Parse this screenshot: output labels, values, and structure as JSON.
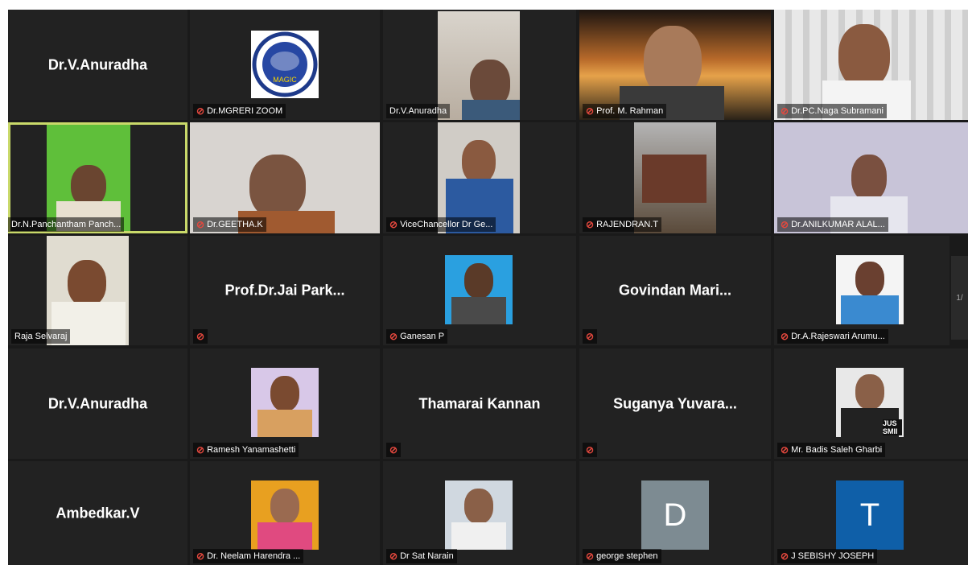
{
  "participants": [
    {
      "big": "Dr.V.Anuradha"
    },
    {
      "label": "Dr.MGRERI ZOOM",
      "logo": "MAGIC"
    },
    {
      "label": "Dr.V.Anuradha"
    },
    {
      "label": "Prof. M. Rahman"
    },
    {
      "label": "Dr.PC.Naga Subramani"
    },
    {
      "label": "Dr.N.Panchantham Panch..."
    },
    {
      "label": "Dr.GEETHA.K"
    },
    {
      "label": "ViceChancellor Dr Ge..."
    },
    {
      "label": "RAJENDRAN.T"
    },
    {
      "label": "Dr.ANILKUMAR ALAL..."
    },
    {
      "label": "Raja Selvaraj"
    },
    {
      "big": "Prof.Dr.Jai  Park..."
    },
    {
      "label": "Ganesan P"
    },
    {
      "big": "Govindan  Mari..."
    },
    {
      "label": "Dr.A.Rajeswari Arumu..."
    },
    {
      "big": "Dr.V.Anuradha"
    },
    {
      "label": "Ramesh Yanamashetti"
    },
    {
      "big": "Thamarai Kannan"
    },
    {
      "big": "Suganya  Yuvara..."
    },
    {
      "label": "Mr. Badis Saleh Gharbi",
      "poster": "JUS SMII"
    },
    {
      "big": "Ambedkar.V"
    },
    {
      "label": "Dr. Neelam Harendra ..."
    },
    {
      "label": "Dr Sat Narain"
    },
    {
      "label": "george stephen",
      "initial": "D"
    },
    {
      "label": "J SEBISHY JOSEPH",
      "initial": "T"
    }
  ],
  "colors": {
    "active_border": "#c9d96a",
    "muted": "#e5483e",
    "tile": "#222222",
    "initial_gray": "#7d8b92",
    "initial_blue": "#0f5fa8"
  },
  "page_indicator": "1/"
}
